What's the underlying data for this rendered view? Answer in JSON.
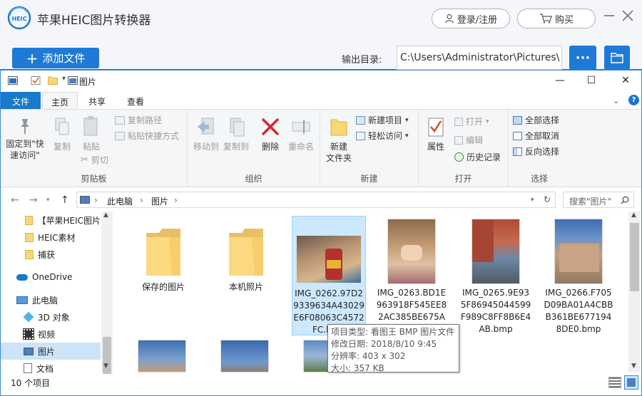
{
  "app": {
    "title": "苹果HEIC图片转换器",
    "logo_text": "HEIC",
    "login": "登录/注册",
    "buy": "购买",
    "add_files": "添加文件",
    "output_label": "输出目录:",
    "output_path": "C:\\Users\\Administrator\\Pictures\\",
    "more": "···",
    "accent": "#1e7ad6"
  },
  "explorer": {
    "title": "图片",
    "tabs": [
      "文件",
      "主页",
      "共享",
      "查看"
    ],
    "ribbon": {
      "clipboard": {
        "label": "剪贴板",
        "pin": "固定到\"快\n速访问\"",
        "copy": "复制",
        "paste": "粘贴",
        "copy_path": "复制路径",
        "paste_shortcut": "粘贴快捷方式",
        "cut": "剪切"
      },
      "organize": {
        "label": "组织",
        "move_to": "移动到",
        "copy_to": "复制到",
        "delete": "删除",
        "rename": "重命名"
      },
      "new": {
        "label": "新建",
        "new_folder": "新建\n文件夹",
        "new_item": "新建项目",
        "easy_access": "轻松访问"
      },
      "open": {
        "label": "打开",
        "properties": "属性",
        "open": "打开",
        "edit": "编辑",
        "history": "历史记录"
      },
      "select": {
        "label": "选择",
        "select_all": "全部选择",
        "select_none": "全部取消",
        "invert": "反向选择"
      }
    },
    "address": [
      "此电脑",
      "图片"
    ],
    "search_placeholder": "搜索\"图片\"",
    "nav": [
      {
        "label": "【苹果HEIC图片",
        "icon": "folder-icon"
      },
      {
        "label": "HEIC素材",
        "icon": "folder-icon"
      },
      {
        "label": "捕获",
        "icon": "folder-icon"
      },
      {
        "label": "OneDrive",
        "icon": "onedrive-icon"
      },
      {
        "label": "此电脑",
        "icon": "computer-icon"
      },
      {
        "label": "3D 对象",
        "icon": "3d-objects-icon"
      },
      {
        "label": "视频",
        "icon": "video-icon"
      },
      {
        "label": "图片",
        "icon": "pictures-icon"
      },
      {
        "label": "文档",
        "icon": "documents-icon"
      }
    ],
    "files": [
      {
        "name": "保存的图片",
        "type": "folder"
      },
      {
        "name": "本机照片",
        "type": "folder"
      },
      {
        "name": "IMG_0262.97D2\n9339634A43029\nE6F08063C4572\nFC.bmp",
        "type": "image",
        "selected": true
      },
      {
        "name": "IMG_0263.BD1E\n963918F545EE8\n2AC385BE675A",
        "type": "image"
      },
      {
        "name": "IMG_0265.9E93\n5F86945044599\nF989C8FF8B6E4\nAB.bmp",
        "type": "image"
      },
      {
        "name": "IMG_0266.F705\nD09BA01A4CBB\nB361BE677194\n8DE0.bmp",
        "type": "image"
      }
    ],
    "tooltip": {
      "type": "项目类型: 看图王 BMP 图片文件",
      "date": "修改日期: 2018/8/10 9:45",
      "resolution": "分辨率: 403 x 302",
      "size": "大小: 357 KB"
    },
    "status_count": "10 个项目"
  }
}
